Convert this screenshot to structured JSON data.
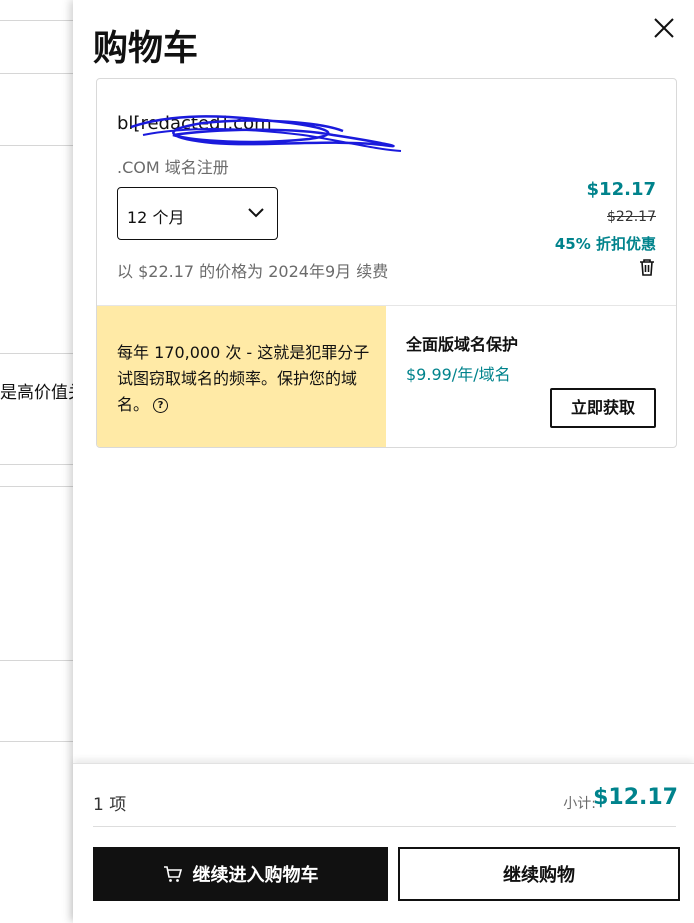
{
  "background": {
    "partial_text": "是高价值关"
  },
  "cart": {
    "title": "购物车",
    "close_icon": "close-icon"
  },
  "item": {
    "domain": "bl[redacted].com",
    "product": ".COM 域名注册",
    "term": "12 个月",
    "price": "$12.17",
    "original_price": "$22.17",
    "discount": "45% 折扣优惠",
    "renewal_note": "以 $22.17 的价格为 2024年9月 续费"
  },
  "promo": {
    "text": "每年 170,000 次 - 这就是犯罪分子试图窃取域名的频率。保护您的域名。",
    "help_icon": "help-circle-icon"
  },
  "upsell": {
    "title": "全面版域名保护",
    "price": "$9.99/年/域名",
    "button": "立即获取"
  },
  "footer": {
    "item_count": "1 项",
    "subtotal_label": "小计:",
    "subtotal": "$12.17",
    "checkout_button": "继续进入购物车",
    "continue_button": "继续购物"
  },
  "colors": {
    "accent": "#00838c",
    "promo_bg": "#ffeaa6",
    "primary_button": "#111111"
  }
}
